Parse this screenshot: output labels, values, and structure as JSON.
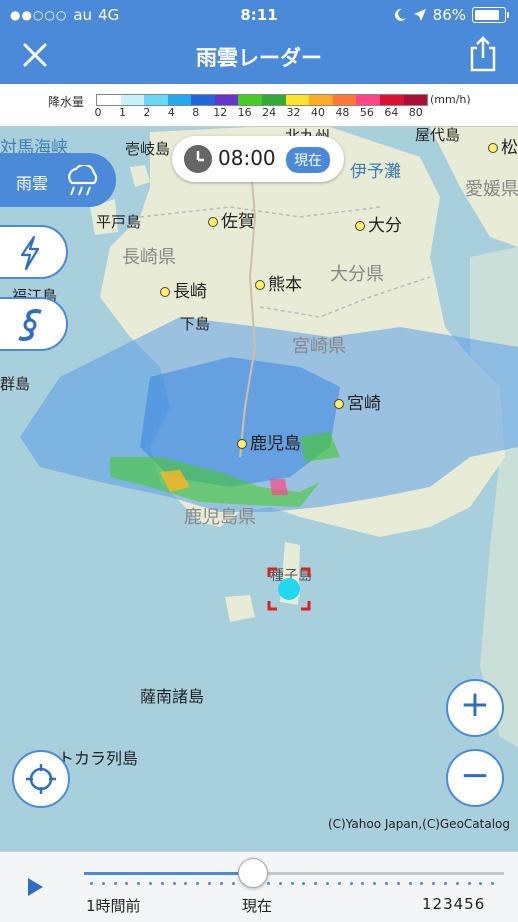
{
  "status_bar": {
    "signal": "●●○○○",
    "carrier": "au",
    "network": "4G",
    "time": "8:11",
    "battery": "86%",
    "battery_level": 0.86
  },
  "header": {
    "title": "雨雲レーダー",
    "close_icon": "close-icon",
    "share_icon": "share-icon"
  },
  "legend": {
    "label": "降水量",
    "unit": "(mm/h)",
    "ticks": [
      "0",
      "1",
      "2",
      "4",
      "8",
      "12",
      "16",
      "24",
      "32",
      "40",
      "48",
      "56",
      "64",
      "80"
    ],
    "colors": [
      "#ffffff",
      "#c8f0ff",
      "#66d8ff",
      "#22aaf0",
      "#2266dd",
      "#6633cc",
      "#44cc22",
      "#33aa33",
      "#ffe22a",
      "#ffaa22",
      "#ff7733",
      "#ff4488",
      "#dd1133",
      "#aa1133"
    ]
  },
  "map": {
    "time_pill": {
      "time": "08:00",
      "now_label": "現在"
    },
    "side_buttons": [
      {
        "label": "雨雲",
        "icon": "rain-cloud-icon"
      },
      {
        "label": "",
        "icon": "lightning-icon"
      },
      {
        "label": "",
        "icon": "typhoon-icon"
      }
    ],
    "labels": {
      "cities": [
        "佐賀",
        "大分",
        "熊本",
        "長崎",
        "宮崎",
        "鹿児島"
      ],
      "prefectures": [
        "長崎県",
        "大分県",
        "宮崎県",
        "鹿児島県",
        "愛媛県"
      ],
      "places": [
        "壱岐島",
        "平戸島",
        "福江島",
        "下島",
        "群島",
        "北九州",
        "屋代島",
        "松",
        "対馬海峡",
        "伊予灘",
        "種子島",
        "薩南諸島",
        "トカラ列島"
      ]
    },
    "zoom_in_label": "+",
    "zoom_out_label": "−",
    "copyright": "(C)Yahoo Japan,(C)GeoCatalog"
  },
  "timeline": {
    "play_icon": "play-icon",
    "progress": 0.4,
    "labels": {
      "past": "1時間前",
      "now": "現在",
      "future": "123456"
    }
  }
}
